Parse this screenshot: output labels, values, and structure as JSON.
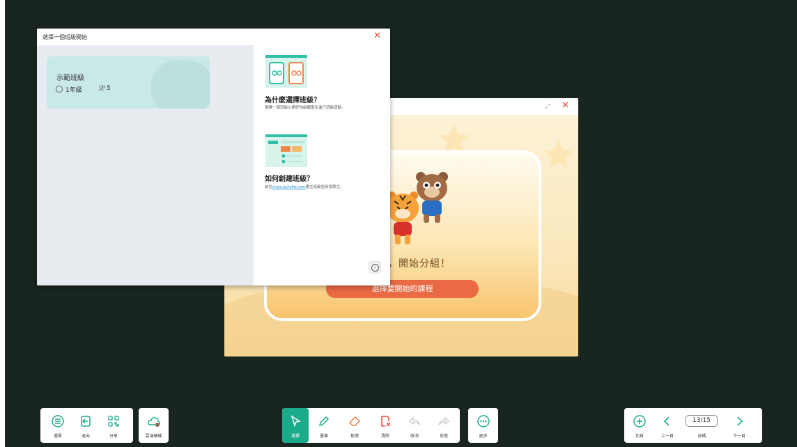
{
  "activity_window": {
    "text_visible": "冊，開始分組！",
    "start_button": "選擇要開始的課程"
  },
  "class_dialog": {
    "title": "選擇一個班級開始",
    "class_card": {
      "name": "示範班級",
      "grade": "1年級",
      "student_count": "5"
    },
    "why_title": "為什麼選擇班級？",
    "why_desc": "選擇一個班級以更好地組織學生進行班級活動。",
    "how_title": "如何創建班級？",
    "how_desc_prefix": "前往",
    "how_link": "class.bytello.com",
    "how_desc_suffix": "建立班級並新增學生。"
  },
  "toolbar_left": [
    {
      "label": "選單",
      "icon": "menu-icon"
    },
    {
      "label": "退出",
      "icon": "exit-icon"
    },
    {
      "label": "分享",
      "icon": "qr-code-icon"
    }
  ],
  "toolbar_cloud": {
    "label": "雲端硬碟",
    "icon": "cloud-icon"
  },
  "toolbar_center": [
    {
      "label": "選擇",
      "icon": "cursor-icon"
    },
    {
      "label": "畫筆",
      "icon": "pen-icon"
    },
    {
      "label": "板擦",
      "icon": "eraser-icon"
    },
    {
      "label": "清除",
      "icon": "clear-icon"
    },
    {
      "label": "取消",
      "icon": "undo-icon"
    },
    {
      "label": "恢復",
      "icon": "redo-icon"
    }
  ],
  "toolbar_more": {
    "label": "更多",
    "icon": "more-icon"
  },
  "toolbar_right": {
    "add_label": "加頁",
    "prev_label": "上一頁",
    "page_value": "13/15",
    "page_label": "頁碼",
    "next_label": "下一頁"
  },
  "colors": {
    "accent": "#1aab8b",
    "close": "#e84a3c",
    "start_button": "#ea6a44",
    "background": "#19261f"
  }
}
